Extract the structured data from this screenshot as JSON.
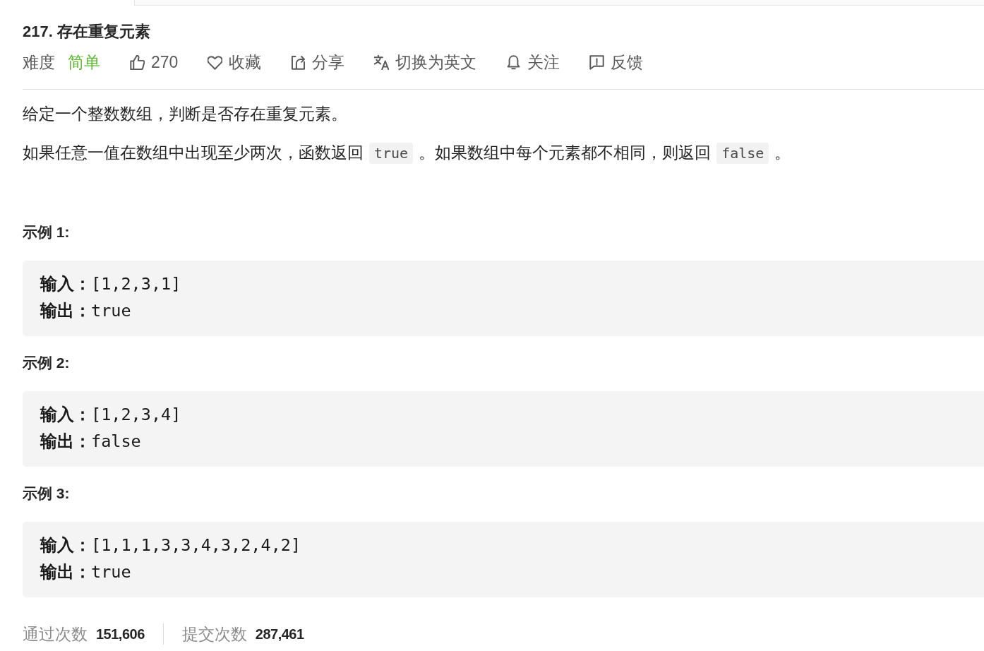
{
  "problem": {
    "title": "217. 存在重复元素",
    "difficulty_label": "难度",
    "difficulty": "简单",
    "actions": [
      {
        "kind": "like",
        "label": "270"
      },
      {
        "kind": "favorite",
        "label": "收藏"
      },
      {
        "kind": "share",
        "label": "分享"
      },
      {
        "kind": "translate",
        "label": "切换为英文"
      },
      {
        "kind": "follow",
        "label": "关注"
      },
      {
        "kind": "feedback",
        "label": "反馈"
      }
    ]
  },
  "description": [
    [
      {
        "kind": "text",
        "text": "给定一个整数数组，判断是否存在重复元素。"
      }
    ],
    [
      {
        "kind": "text",
        "text": "如果任意一值在数组中出现至少两次，函数返回"
      },
      {
        "kind": "code",
        "text": "true"
      },
      {
        "kind": "text",
        "text": "。如果数组中每个元素都不相同，则返回"
      },
      {
        "kind": "code",
        "text": "false"
      },
      {
        "kind": "text",
        "text": "。"
      }
    ]
  ],
  "examples": [
    {
      "heading": "示例 1:",
      "lines": [
        "**输入：**[1,2,3,1]",
        "**输出：**true"
      ]
    },
    {
      "heading": "示例 2:",
      "lines": [
        "**输入：**[1,2,3,4]",
        "**输出：**false"
      ]
    },
    {
      "heading": "示例 3:",
      "lines": [
        "**输入：**[1,1,1,3,3,4,3,2,4,2]",
        "**输出：**true"
      ]
    }
  ],
  "stats": [
    {
      "label": "通过次数",
      "value": "151,606"
    },
    {
      "label": "提交次数",
      "value": "287,461"
    }
  ]
}
